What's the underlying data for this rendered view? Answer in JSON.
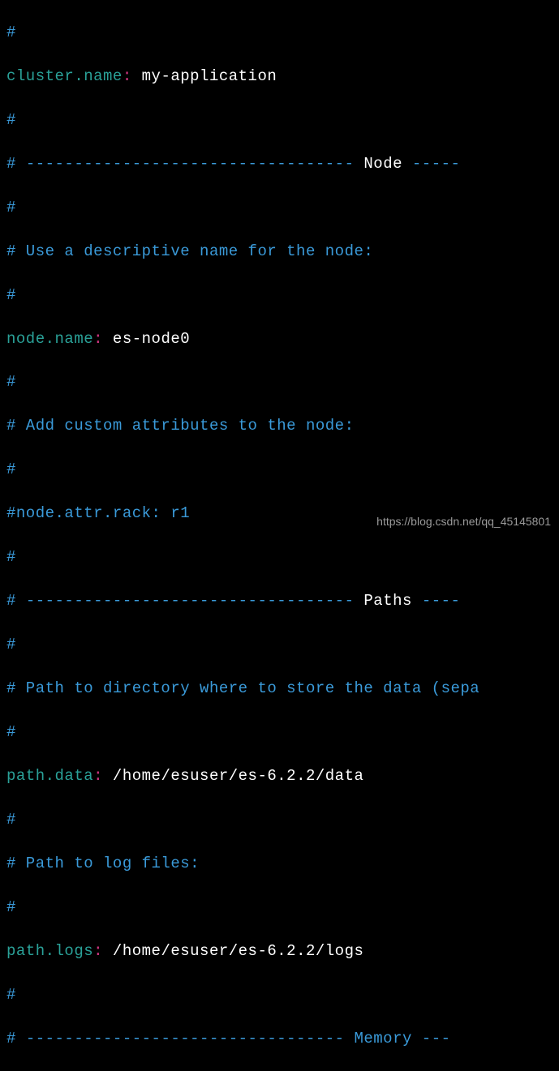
{
  "lines": {
    "l0": "#",
    "k1": "cluster.name",
    "v1": " my-application",
    "l2": "#",
    "l3_pre": "# ",
    "l3_dash": "----------------------------------",
    "l3_label": " Node ",
    "l3_post": "-----",
    "l4": "#",
    "l5": "# Use a descriptive name for the node:",
    "l6": "#",
    "k7": "node.name",
    "v7": " es-node0",
    "l8": "#",
    "l9": "# Add custom attributes to the node:",
    "l10": "#",
    "l11": "#node.attr.rack: r1",
    "l12": "#",
    "l13_pre": "# ",
    "l13_dash": "----------------------------------",
    "l13_label": " Paths ",
    "l13_post": "----",
    "l14": "#",
    "l15": "# Path to directory where to store the data (sepa",
    "l16": "#",
    "k17": "path.data",
    "v17": " /home/esuser/es-6.2.2/data",
    "l18": "#",
    "l19": "# Path to log files:",
    "l20": "#",
    "k21": "path.logs",
    "v21": " /home/esuser/es-6.2.2/logs",
    "l22": "#",
    "l23_pre": "# ",
    "l23_dash": "---------------------------------",
    "l23_label": " Memory ",
    "l23_post": "---"
  },
  "watermark": "https://blog.csdn.net/qq_45145801"
}
